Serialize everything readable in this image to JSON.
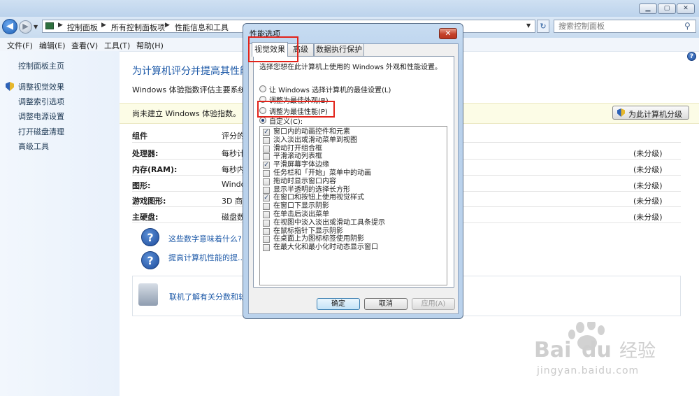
{
  "address": {
    "crumbs": [
      "控制面板",
      "所有控制面板项",
      "性能信息和工具"
    ],
    "search_placeholder": "搜索控制面板"
  },
  "menu": [
    "文件(F)",
    "编辑(E)",
    "查看(V)",
    "工具(T)",
    "帮助(H)"
  ],
  "sidebar": {
    "items": [
      "控制面板主页",
      "调整视觉效果",
      "调整索引选项",
      "调整电源设置",
      "打开磁盘清理",
      "高级工具"
    ]
  },
  "main": {
    "title": "为计算机评分并提高其性能",
    "description": "Windows 体验指数评估主要系统组",
    "status": "尚未建立 Windows 体验指数。",
    "rate_button": "为此计算机分级",
    "headers": {
      "component": "组件",
      "rating": "评分的'"
    },
    "rows": [
      {
        "label": "处理器:",
        "desc": "每秒计",
        "score": "(未分级)"
      },
      {
        "label": "内存(RAM):",
        "desc": "每秒内",
        "score": "(未分级)"
      },
      {
        "label": "图形:",
        "desc": "Windo",
        "score": "(未分级)"
      },
      {
        "label": "游戏图形:",
        "desc": "3D 商务",
        "score": "(未分级)"
      },
      {
        "label": "主硬盘:",
        "desc": "磁盘数",
        "score": "(未分级)"
      }
    ],
    "help_links": [
      "这些数字意味着什么?",
      "提高计算机性能的提..."
    ],
    "online_link": "联机了解有关分数和软件"
  },
  "dialog": {
    "title": "性能选项",
    "close_label": "✕",
    "tabs": [
      "视觉效果",
      "高级",
      "数据执行保护"
    ],
    "instruction": "选择您想在此计算机上使用的 Windows 外观和性能设置。",
    "radios": [
      {
        "label": "让 Windows 选择计算机的最佳设置(L)",
        "checked": false
      },
      {
        "label": "调整为最佳外观(B)",
        "checked": false
      },
      {
        "label": "调整为最佳性能(P)",
        "checked": false
      },
      {
        "label": "自定义(C):",
        "checked": true
      }
    ],
    "options": [
      {
        "label": "窗口内的动画控件和元素",
        "checked": true
      },
      {
        "label": "淡入淡出或滑动菜单到视图",
        "checked": false
      },
      {
        "label": "滑动打开组合框",
        "checked": false
      },
      {
        "label": "平滑滚动列表框",
        "checked": false
      },
      {
        "label": "平滑屏幕字体边缘",
        "checked": true
      },
      {
        "label": "任务栏和「开始」菜单中的动画",
        "checked": false
      },
      {
        "label": "拖动时显示窗口内容",
        "checked": false
      },
      {
        "label": "显示半透明的选择长方形",
        "checked": false
      },
      {
        "label": "在窗口和按钮上使用视觉样式",
        "checked": true
      },
      {
        "label": "在窗口下显示阴影",
        "checked": false
      },
      {
        "label": "在单击后淡出菜单",
        "checked": false
      },
      {
        "label": "在视图中淡入淡出或滑动工具条提示",
        "checked": false
      },
      {
        "label": "在鼠标指针下显示阴影",
        "checked": false
      },
      {
        "label": "在桌面上为图标标签使用阴影",
        "checked": false
      },
      {
        "label": "在最大化和最小化时动态显示窗口",
        "checked": false
      }
    ],
    "buttons": {
      "ok": "确定",
      "cancel": "取消",
      "apply": "应用(A)"
    }
  },
  "watermark": {
    "brand": "Bai",
    "brand2": "du",
    "cn": "经验",
    "url": "jingyan.baidu.com"
  },
  "colors": {
    "accent": "#1e5aa8",
    "highlight_box": "#e2231a",
    "status_bg": "#fcfce6"
  }
}
